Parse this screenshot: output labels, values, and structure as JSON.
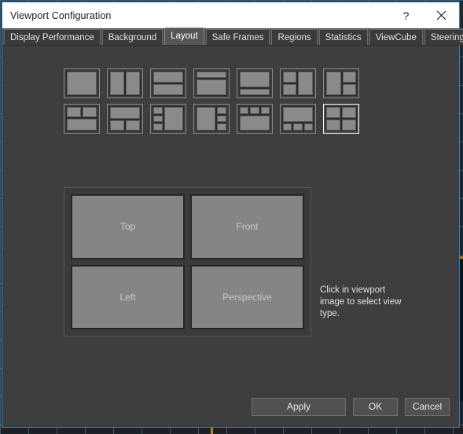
{
  "background": {
    "grid_color": "#46698720",
    "accent_color": "#b6841e"
  },
  "dialog": {
    "title": "Viewport Configuration",
    "border_color": "#2b7fd4",
    "body_color": "#3e3e3e",
    "titlebar": {
      "help_icon": "question-mark-icon",
      "help_glyph": "?",
      "close_icon": "close-icon",
      "close_glyph": "✕"
    },
    "tabs": [
      {
        "label": "Display Performance",
        "active": false
      },
      {
        "label": "Background",
        "active": false
      },
      {
        "label": "Layout",
        "active": true
      },
      {
        "label": "Safe Frames",
        "active": false
      },
      {
        "label": "Regions",
        "active": false
      },
      {
        "label": "Statistics",
        "active": false
      },
      {
        "label": "ViewCube",
        "active": false
      },
      {
        "label": "SteeringWheels",
        "active": false
      }
    ],
    "layout_presets": {
      "selected_index": 13,
      "row1": [
        {
          "name": "preset-single",
          "type": "single"
        },
        {
          "name": "preset-two-columns",
          "type": "two-cols"
        },
        {
          "name": "preset-two-rows",
          "type": "two-rows"
        },
        {
          "name": "preset-thin-top-big-bottom",
          "type": "thin-top"
        },
        {
          "name": "preset-big-top-thin-bottom",
          "type": "thin-bottom"
        },
        {
          "name": "preset-left-split-right-full",
          "type": "left-split"
        },
        {
          "name": "preset-left-full-right-split",
          "type": "right-split"
        }
      ],
      "row2": [
        {
          "name": "preset-two-top-one-bottom",
          "type": "two-top-one-bottom"
        },
        {
          "name": "preset-one-top-two-bottom",
          "type": "one-top-two-bottom"
        },
        {
          "name": "preset-three-left-one-right",
          "type": "three-left"
        },
        {
          "name": "preset-one-left-three-right",
          "type": "three-right"
        },
        {
          "name": "preset-three-top-one-bottom",
          "type": "three-top"
        },
        {
          "name": "preset-one-top-three-bottom",
          "type": "three-bottom"
        },
        {
          "name": "preset-four-quadrants",
          "type": "quad"
        }
      ]
    },
    "viewport_preview": {
      "cells": [
        {
          "label": "Top"
        },
        {
          "label": "Front"
        },
        {
          "label": "Left"
        },
        {
          "label": "Perspective"
        }
      ]
    },
    "hint_text": "Click in viewport image to select view type.",
    "buttons": {
      "apply": "Apply",
      "ok": "OK",
      "cancel": "Cancel"
    }
  }
}
